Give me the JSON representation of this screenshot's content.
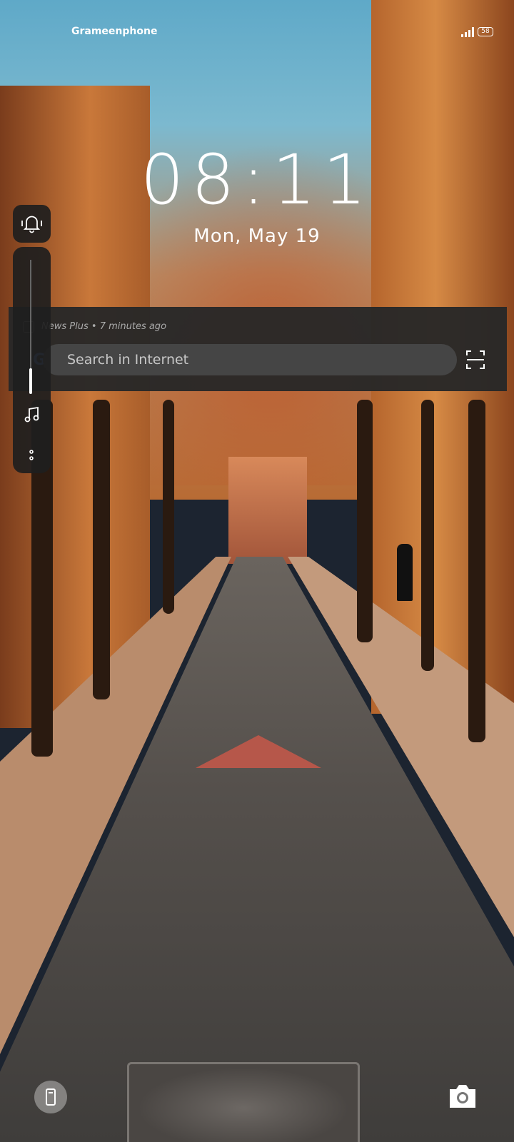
{
  "status_bar": {
    "carrier": "Grameenphone",
    "battery": "58",
    "signal_icon": "signal-bars-icon"
  },
  "lock_screen": {
    "time": "08:11",
    "date": "Mon, May 19"
  },
  "notification": {
    "app_name": "News Plus",
    "separator": "•",
    "time_ago": "7 minutes ago",
    "search_placeholder": "Search in Internet",
    "logo_glyph": "G"
  },
  "volume_panel": {
    "ringer_icon": "vibrate-bell-icon",
    "level_fraction": 0.19,
    "media_icon": "music-note-icon",
    "more_icon": "more-vertical-icon"
  },
  "shortcuts": {
    "left": "flashlight-icon",
    "right": "camera-icon"
  },
  "colors": {
    "panel_bg": "#1e1e1e",
    "search_bg": "#454545",
    "text": "#ffffff"
  }
}
